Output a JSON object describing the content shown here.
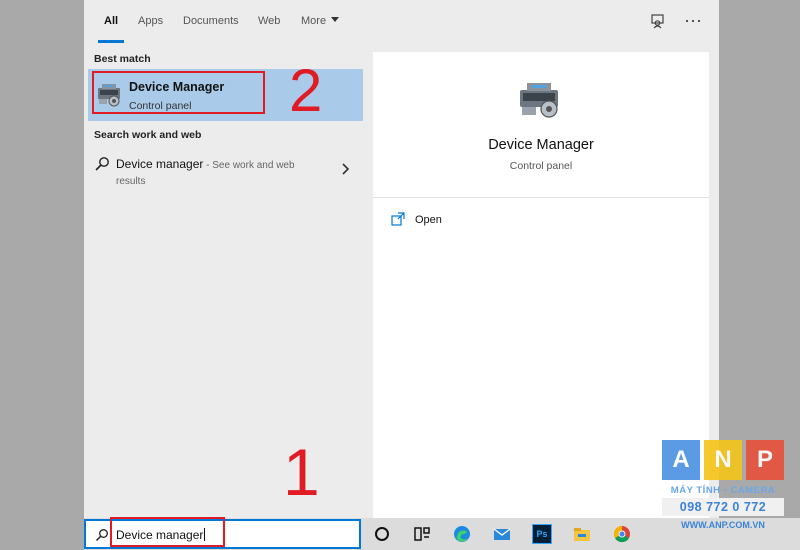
{
  "nav": {
    "tabs": [
      {
        "label": "All",
        "active": true
      },
      {
        "label": "Apps"
      },
      {
        "label": "Documents"
      },
      {
        "label": "Web"
      },
      {
        "label": "More"
      }
    ],
    "icons": [
      "feedback-icon",
      "more-options-icon"
    ]
  },
  "best_match": {
    "section_label": "Best match",
    "title": "Device Manager",
    "subtitle": "Control panel"
  },
  "search_web": {
    "section_label": "Search work and web",
    "query": "Device manager",
    "suffix": " - See work and web results"
  },
  "preview": {
    "title": "Device Manager",
    "subtitle": "Control panel",
    "actions": [
      {
        "label": "Open",
        "icon": "open-icon"
      }
    ]
  },
  "search_box": {
    "value": "Device manager",
    "icon": "search-icon"
  },
  "annotations": {
    "step1": "1",
    "step2": "2",
    "color": "#e01b24"
  },
  "taskbar": {
    "icons": [
      "cortana-icon",
      "task-view-icon",
      "edge-icon",
      "mail-icon",
      "photoshop-icon",
      "file-explorer-icon",
      "chrome-icon"
    ],
    "photoshop_label": "Ps"
  },
  "watermark": {
    "letters": [
      "A",
      "N",
      "P"
    ],
    "tagline": "MÁY TÍNH - CAMERA",
    "phone": "098 772 0 772",
    "website": "WWW.ANP.COM.VN",
    "colors": [
      "#4a90e2",
      "#f5c518",
      "#e8503a"
    ]
  },
  "accent_color": "#0078d7",
  "highlight_color": "#a9cbe9"
}
